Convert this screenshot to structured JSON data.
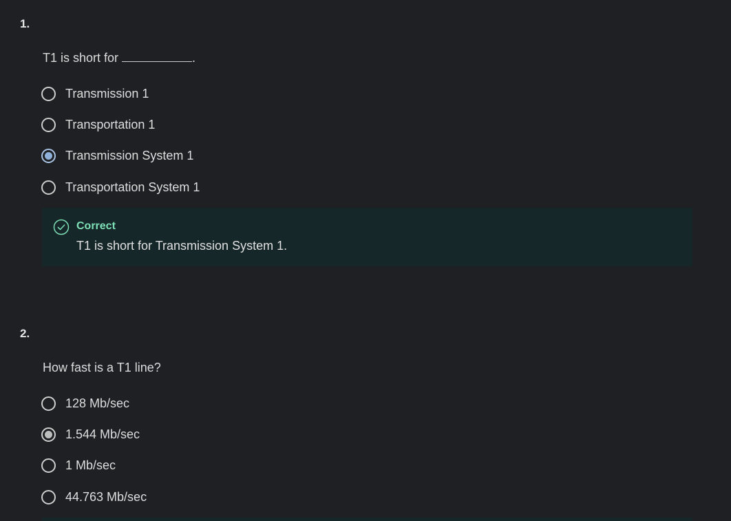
{
  "questions": [
    {
      "number": "1.",
      "prompt_before": "T1 is short for",
      "prompt_after": ".",
      "options": [
        {
          "label": "Transmission 1",
          "selected": false
        },
        {
          "label": "Transportation 1",
          "selected": false
        },
        {
          "label": "Transmission System 1",
          "selected": true
        },
        {
          "label": "Transportation System 1",
          "selected": false
        }
      ],
      "feedback": {
        "status": "Correct",
        "text": "T1 is short for Transmission System 1."
      }
    },
    {
      "number": "2.",
      "prompt": "How fast is a T1 line?",
      "options": [
        {
          "label": "128 Mb/sec",
          "selected": false
        },
        {
          "label": "1.544 Mb/sec",
          "selected": true
        },
        {
          "label": "1 Mb/sec",
          "selected": false
        },
        {
          "label": "44.763 Mb/sec",
          "selected": false
        }
      ]
    }
  ],
  "colors": {
    "background": "#1f2023",
    "feedback_bg": "#16272a",
    "correct_accent": "#7ee0b6",
    "selected_blue": "#8fb1d9",
    "selected_grey": "#bdbdbd"
  },
  "icons": {
    "correct": "check-circle-icon"
  }
}
